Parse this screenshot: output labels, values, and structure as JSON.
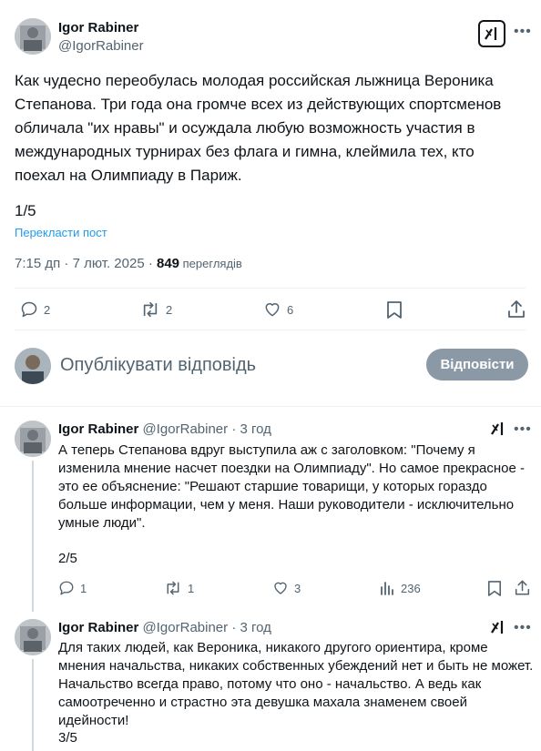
{
  "main_post": {
    "author_name": "Igor Rabiner",
    "author_handle": "@IgorRabiner",
    "text": "Как чудесно переобулась молодая российская лыжница Вероника Степанова. Три года она громче всех из действующих спортсменов обличала \"их нравы\" и осуждала любую возможность участия в международных турнирах без флага и гимна, клеймила тех, кто поехал на Олимпиаду в Париж.",
    "counter": "1/5",
    "translate_link": "Перекласти пост",
    "time": "7:15 дп · 7 лют. 2025 · ",
    "views": "849",
    "views_label": " переглядів",
    "replies": "2",
    "reposts": "2",
    "likes": "6"
  },
  "composer": {
    "placeholder": "Опублікувати відповідь",
    "reply_button": "Відповісти"
  },
  "replies": [
    {
      "author_name": "Igor Rabiner",
      "author_handle": "@IgorRabiner",
      "time": "· 3 год",
      "text": "А теперь Степанова вдруг выступила аж с заголовком: \"Почему я изменила мнение насчет поездки на Олимпиаду\". Но самое прекрасное - это ее объяснение: \"Решают старшие товарищи, у которых гораздо больше информации, чем у меня. Наши руководители - исключительно умные люди\".",
      "counter": "2/5",
      "replies": "1",
      "reposts": "1",
      "likes": "3",
      "views": "236"
    },
    {
      "author_name": "Igor Rabiner",
      "author_handle": "@IgorRabiner",
      "time": "· 3 год",
      "text": "Для таких людей, как Вероника, никакого другого ориентира, кроме мнения начальства, никаких собственных убеждений нет и быть не может. Начальство всегда право, потому что оно - начальство. А ведь как самоотреченно и страстно эта девушка махала знаменем своей идейности!",
      "counter": "3/5"
    }
  ],
  "colors": {
    "text": "#0f1419",
    "secondary": "#536471",
    "link": "#1d9bf0",
    "reply_button_bg": "#8b98a5",
    "divider": "#eff3f4"
  }
}
